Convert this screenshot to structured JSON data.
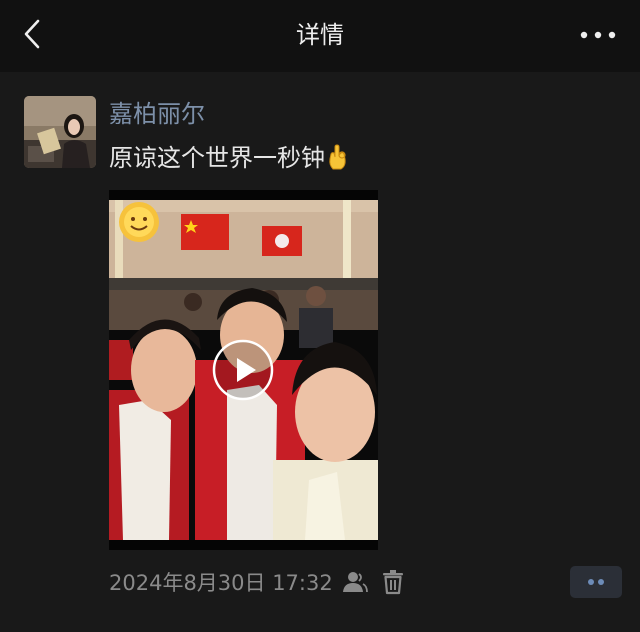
{
  "header": {
    "title": "详情",
    "back_icon": "chevron-left-icon",
    "more_icon": "more-horizontal-icon"
  },
  "post": {
    "author": "嘉柏丽尔",
    "text": "原谅这个世界一秒钟",
    "text_emoji": "hand-emoji",
    "media": {
      "type": "video",
      "play_icon": "play-icon"
    },
    "timestamp": "2024年8月30日 17:32",
    "visibility_icon": "person-icon",
    "delete_icon": "trash-icon",
    "action_icon": "more-dots-icon"
  },
  "colors": {
    "background": "#191919",
    "topbar": "#111111",
    "author_name": "#7d90a9",
    "text": "#e6e6e6",
    "meta": "#8a8a8a",
    "action_button_bg": "#2b2f37",
    "action_dots": "#6d8cb8"
  }
}
